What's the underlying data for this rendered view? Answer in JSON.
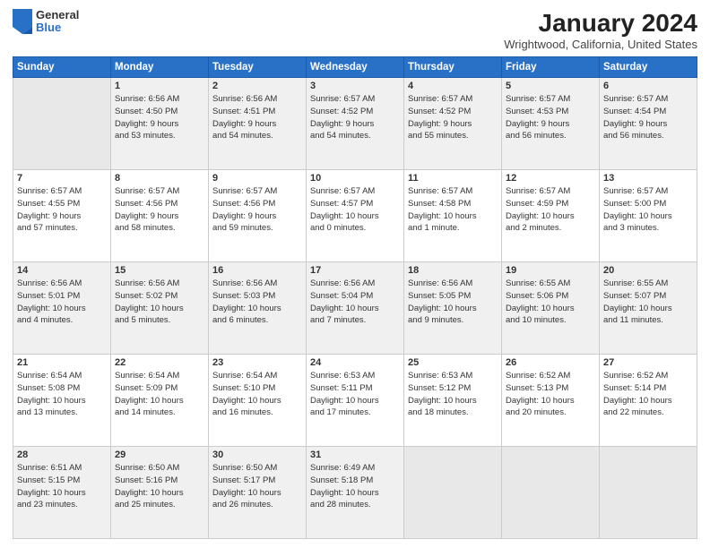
{
  "header": {
    "logo_general": "General",
    "logo_blue": "Blue",
    "month_title": "January 2024",
    "location": "Wrightwood, California, United States"
  },
  "weekdays": [
    "Sunday",
    "Monday",
    "Tuesday",
    "Wednesday",
    "Thursday",
    "Friday",
    "Saturday"
  ],
  "weeks": [
    [
      {
        "day": "",
        "content": ""
      },
      {
        "day": "1",
        "content": "Sunrise: 6:56 AM\nSunset: 4:50 PM\nDaylight: 9 hours\nand 53 minutes."
      },
      {
        "day": "2",
        "content": "Sunrise: 6:56 AM\nSunset: 4:51 PM\nDaylight: 9 hours\nand 54 minutes."
      },
      {
        "day": "3",
        "content": "Sunrise: 6:57 AM\nSunset: 4:52 PM\nDaylight: 9 hours\nand 54 minutes."
      },
      {
        "day": "4",
        "content": "Sunrise: 6:57 AM\nSunset: 4:52 PM\nDaylight: 9 hours\nand 55 minutes."
      },
      {
        "day": "5",
        "content": "Sunrise: 6:57 AM\nSunset: 4:53 PM\nDaylight: 9 hours\nand 56 minutes."
      },
      {
        "day": "6",
        "content": "Sunrise: 6:57 AM\nSunset: 4:54 PM\nDaylight: 9 hours\nand 56 minutes."
      }
    ],
    [
      {
        "day": "7",
        "content": "Sunrise: 6:57 AM\nSunset: 4:55 PM\nDaylight: 9 hours\nand 57 minutes."
      },
      {
        "day": "8",
        "content": "Sunrise: 6:57 AM\nSunset: 4:56 PM\nDaylight: 9 hours\nand 58 minutes."
      },
      {
        "day": "9",
        "content": "Sunrise: 6:57 AM\nSunset: 4:56 PM\nDaylight: 9 hours\nand 59 minutes."
      },
      {
        "day": "10",
        "content": "Sunrise: 6:57 AM\nSunset: 4:57 PM\nDaylight: 10 hours\nand 0 minutes."
      },
      {
        "day": "11",
        "content": "Sunrise: 6:57 AM\nSunset: 4:58 PM\nDaylight: 10 hours\nand 1 minute."
      },
      {
        "day": "12",
        "content": "Sunrise: 6:57 AM\nSunset: 4:59 PM\nDaylight: 10 hours\nand 2 minutes."
      },
      {
        "day": "13",
        "content": "Sunrise: 6:57 AM\nSunset: 5:00 PM\nDaylight: 10 hours\nand 3 minutes."
      }
    ],
    [
      {
        "day": "14",
        "content": "Sunrise: 6:56 AM\nSunset: 5:01 PM\nDaylight: 10 hours\nand 4 minutes."
      },
      {
        "day": "15",
        "content": "Sunrise: 6:56 AM\nSunset: 5:02 PM\nDaylight: 10 hours\nand 5 minutes."
      },
      {
        "day": "16",
        "content": "Sunrise: 6:56 AM\nSunset: 5:03 PM\nDaylight: 10 hours\nand 6 minutes."
      },
      {
        "day": "17",
        "content": "Sunrise: 6:56 AM\nSunset: 5:04 PM\nDaylight: 10 hours\nand 7 minutes."
      },
      {
        "day": "18",
        "content": "Sunrise: 6:56 AM\nSunset: 5:05 PM\nDaylight: 10 hours\nand 9 minutes."
      },
      {
        "day": "19",
        "content": "Sunrise: 6:55 AM\nSunset: 5:06 PM\nDaylight: 10 hours\nand 10 minutes."
      },
      {
        "day": "20",
        "content": "Sunrise: 6:55 AM\nSunset: 5:07 PM\nDaylight: 10 hours\nand 11 minutes."
      }
    ],
    [
      {
        "day": "21",
        "content": "Sunrise: 6:54 AM\nSunset: 5:08 PM\nDaylight: 10 hours\nand 13 minutes."
      },
      {
        "day": "22",
        "content": "Sunrise: 6:54 AM\nSunset: 5:09 PM\nDaylight: 10 hours\nand 14 minutes."
      },
      {
        "day": "23",
        "content": "Sunrise: 6:54 AM\nSunset: 5:10 PM\nDaylight: 10 hours\nand 16 minutes."
      },
      {
        "day": "24",
        "content": "Sunrise: 6:53 AM\nSunset: 5:11 PM\nDaylight: 10 hours\nand 17 minutes."
      },
      {
        "day": "25",
        "content": "Sunrise: 6:53 AM\nSunset: 5:12 PM\nDaylight: 10 hours\nand 18 minutes."
      },
      {
        "day": "26",
        "content": "Sunrise: 6:52 AM\nSunset: 5:13 PM\nDaylight: 10 hours\nand 20 minutes."
      },
      {
        "day": "27",
        "content": "Sunrise: 6:52 AM\nSunset: 5:14 PM\nDaylight: 10 hours\nand 22 minutes."
      }
    ],
    [
      {
        "day": "28",
        "content": "Sunrise: 6:51 AM\nSunset: 5:15 PM\nDaylight: 10 hours\nand 23 minutes."
      },
      {
        "day": "29",
        "content": "Sunrise: 6:50 AM\nSunset: 5:16 PM\nDaylight: 10 hours\nand 25 minutes."
      },
      {
        "day": "30",
        "content": "Sunrise: 6:50 AM\nSunset: 5:17 PM\nDaylight: 10 hours\nand 26 minutes."
      },
      {
        "day": "31",
        "content": "Sunrise: 6:49 AM\nSunset: 5:18 PM\nDaylight: 10 hours\nand 28 minutes."
      },
      {
        "day": "",
        "content": ""
      },
      {
        "day": "",
        "content": ""
      },
      {
        "day": "",
        "content": ""
      }
    ]
  ]
}
